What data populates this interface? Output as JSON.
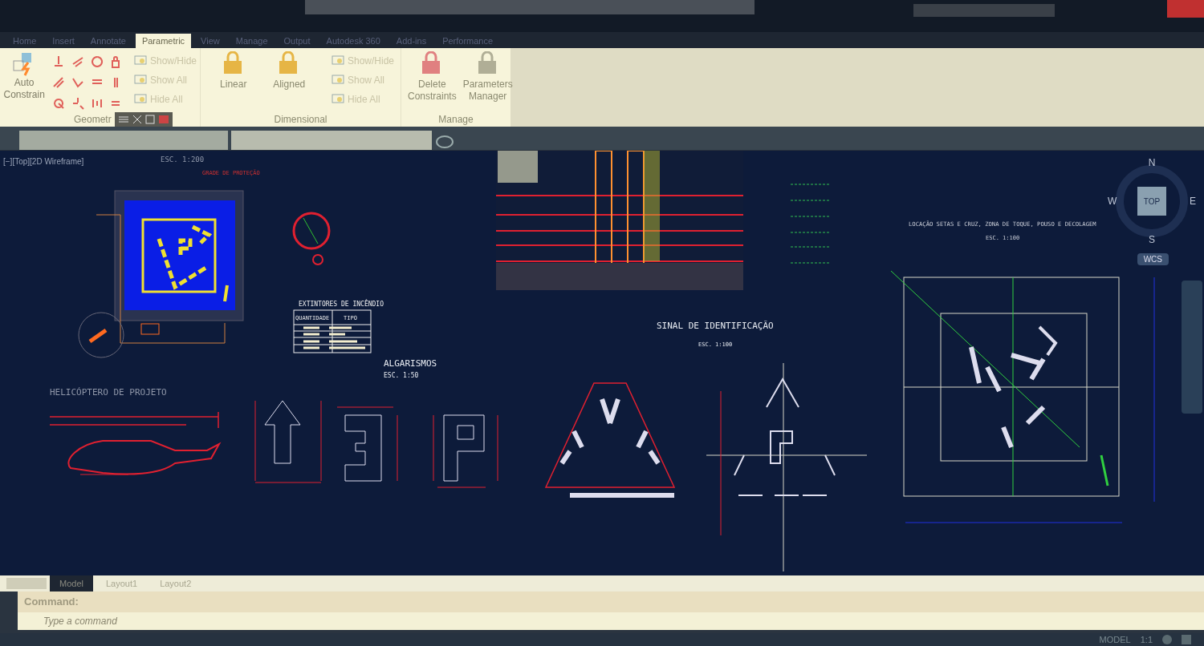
{
  "ribbon_tabs": [
    {
      "label": "Home",
      "selected": false
    },
    {
      "label": "Insert",
      "selected": false
    },
    {
      "label": "Annotate",
      "selected": false
    },
    {
      "label": "Parametric",
      "selected": true
    },
    {
      "label": "View",
      "selected": false
    },
    {
      "label": "Manage",
      "selected": false
    },
    {
      "label": "Output",
      "selected": false
    },
    {
      "label": "Autodesk 360",
      "selected": false
    },
    {
      "label": "Add-ins",
      "selected": false
    },
    {
      "label": "Performance",
      "selected": false
    }
  ],
  "ribbon": {
    "geometric": {
      "title": "Geometr",
      "button": "Auto Constrain",
      "toggles": [
        "Show/Hide",
        "Show All",
        "Hide All"
      ]
    },
    "dimensional": {
      "title": "Dimensional",
      "buttons": [
        "Linear",
        "Aligned"
      ],
      "toggles": [
        "Show/Hide",
        "Show All",
        "Hide All"
      ]
    },
    "manage": {
      "title": "Manage",
      "buttons": [
        "Delete Constraints",
        "Parameters Manager"
      ]
    }
  },
  "viewport": {
    "label": "[−][Top][2D Wireframe]"
  },
  "drawing": {
    "helipad": {
      "scale": "ESC. 1:200",
      "note": "GRADE DE PROTEÇÃO"
    },
    "extinguishers": {
      "title": "EXTINTORES DE INCÊNDIO",
      "columns": [
        "QUANTIDADE",
        "TIPO"
      ]
    },
    "numerals": {
      "title": "ALGARISMOS",
      "scale": "ESC. 1:50"
    },
    "helicopter": {
      "title": "HELICÓPTERO DE PROJETO"
    },
    "sign": {
      "title": "SINAL DE IDENTIFICAÇÃO",
      "scale": "ESC. 1:100"
    },
    "location": {
      "title": "LOCAÇÃO SETAS E CRUZ, ZONA DE TOQUE, POUSO E DECOLAGEM",
      "scale": "ESC. 1:100"
    }
  },
  "viewcube": {
    "north": "N",
    "south": "S",
    "east": "E",
    "west": "W",
    "face": "TOP",
    "ucs": "WCS"
  },
  "layout_tabs": [
    {
      "label": "Model",
      "selected": true
    },
    {
      "label": "Layout1",
      "selected": false
    },
    {
      "label": "Layout2",
      "selected": false
    }
  ],
  "command": {
    "prompt": "Command:",
    "placeholder": "Type a command"
  },
  "status_bar": {
    "mode": "MODEL",
    "scale": "1:1"
  }
}
